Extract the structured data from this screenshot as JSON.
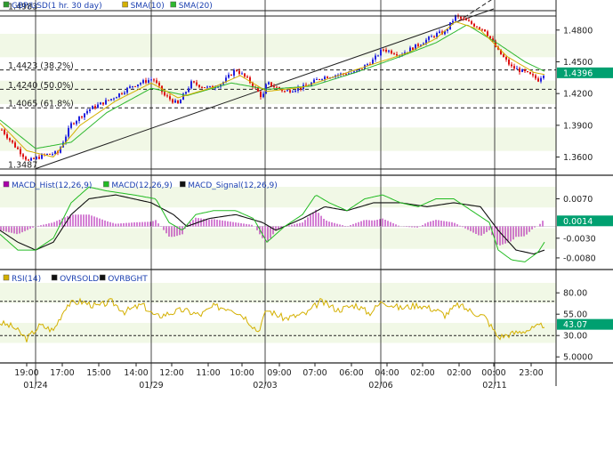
{
  "chart_data": [
    {
      "type": "line",
      "panel": "price",
      "legend": [
        {
          "label": "GBP/USD(1 hr.  30 day)",
          "color": "#2e9a2e"
        },
        {
          "label": "SMA(10)",
          "color": "#d4b000"
        },
        {
          "label": "SMA(20)",
          "color": "#2fb82f"
        }
      ],
      "yticks": [
        "1.4800",
        "1.4500",
        "1.4200",
        "1.3900",
        "1.3600"
      ],
      "ytick_values": [
        1.48,
        1.45,
        1.42,
        1.39,
        1.36
      ],
      "ylim": [
        1.347,
        1.5
      ],
      "current": {
        "label": "1.4396",
        "value": 1.4396
      },
      "hlines": [
        {
          "label": "1.4983",
          "value": 1.4983,
          "style": "solid"
        },
        {
          "label": "1.4423 (38.2%)",
          "value": 1.4423,
          "style": "dashed"
        },
        {
          "label": "1.4240 (50.0%)",
          "value": 1.424,
          "style": "dashed"
        },
        {
          "label": "1.4065 (61.8%)",
          "value": 1.4065,
          "style": "dashed"
        },
        {
          "label": "1.3487",
          "value": 1.3487,
          "style": "solid"
        }
      ],
      "price_keypoints": [
        [
          0,
          1.388
        ],
        [
          15,
          1.372
        ],
        [
          32,
          1.356
        ],
        [
          50,
          1.362
        ],
        [
          65,
          1.364
        ],
        [
          80,
          1.391
        ],
        [
          100,
          1.405
        ],
        [
          125,
          1.415
        ],
        [
          150,
          1.428
        ],
        [
          172,
          1.434
        ],
        [
          185,
          1.418
        ],
        [
          200,
          1.41
        ],
        [
          215,
          1.43
        ],
        [
          235,
          1.425
        ],
        [
          250,
          1.43
        ],
        [
          265,
          1.443
        ],
        [
          280,
          1.432
        ],
        [
          295,
          1.416
        ],
        [
          300,
          1.43
        ],
        [
          320,
          1.422
        ],
        [
          345,
          1.427
        ],
        [
          360,
          1.435
        ],
        [
          380,
          1.438
        ],
        [
          400,
          1.44
        ],
        [
          420,
          1.452
        ],
        [
          430,
          1.462
        ],
        [
          450,
          1.457
        ],
        [
          470,
          1.466
        ],
        [
          490,
          1.476
        ],
        [
          500,
          1.478
        ],
        [
          512,
          1.493
        ],
        [
          525,
          1.488
        ],
        [
          545,
          1.48
        ],
        [
          560,
          1.46
        ],
        [
          575,
          1.445
        ],
        [
          590,
          1.44
        ],
        [
          605,
          1.433
        ],
        [
          612,
          1.44
        ]
      ],
      "sma10_keypoints": [
        [
          0,
          1.392
        ],
        [
          30,
          1.366
        ],
        [
          60,
          1.36
        ],
        [
          90,
          1.39
        ],
        [
          130,
          1.413
        ],
        [
          170,
          1.43
        ],
        [
          200,
          1.416
        ],
        [
          240,
          1.426
        ],
        [
          270,
          1.437
        ],
        [
          300,
          1.422
        ],
        [
          340,
          1.426
        ],
        [
          380,
          1.437
        ],
        [
          420,
          1.448
        ],
        [
          460,
          1.459
        ],
        [
          490,
          1.472
        ],
        [
          512,
          1.488
        ],
        [
          540,
          1.48
        ],
        [
          570,
          1.455
        ],
        [
          600,
          1.44
        ],
        [
          612,
          1.438
        ]
      ],
      "sma20_keypoints": [
        [
          0,
          1.395
        ],
        [
          40,
          1.368
        ],
        [
          80,
          1.374
        ],
        [
          120,
          1.402
        ],
        [
          170,
          1.425
        ],
        [
          210,
          1.418
        ],
        [
          260,
          1.43
        ],
        [
          300,
          1.424
        ],
        [
          350,
          1.427
        ],
        [
          400,
          1.44
        ],
        [
          450,
          1.455
        ],
        [
          490,
          1.468
        ],
        [
          525,
          1.485
        ],
        [
          560,
          1.467
        ],
        [
          590,
          1.45
        ],
        [
          612,
          1.441
        ]
      ],
      "trendline": {
        "from": [
          40,
          1.349
        ],
        "to": [
          555,
          1.5
        ]
      }
    },
    {
      "type": "line",
      "panel": "macd",
      "legend": [
        {
          "label": "MACD_Hist(12,26,9)",
          "color": "#aa00aa"
        },
        {
          "label": "MACD(12,26,9)",
          "color": "#22bb22"
        },
        {
          "label": "MACD_Signal(12,26,9)",
          "color": "#111111"
        }
      ],
      "yticks": [
        "0.0070",
        "-0.0030",
        "-0.0080"
      ],
      "ytick_values": [
        0.007,
        -0.003,
        -0.008
      ],
      "ylim": [
        -0.0105,
        0.0105
      ],
      "current": {
        "label": "0.0014",
        "value": 0.0014
      },
      "macd_keypoints": [
        [
          0,
          -0.002
        ],
        [
          20,
          -0.006
        ],
        [
          40,
          -0.006
        ],
        [
          60,
          -0.003
        ],
        [
          80,
          0.006
        ],
        [
          100,
          0.01
        ],
        [
          120,
          0.009
        ],
        [
          150,
          0.008
        ],
        [
          175,
          0.007
        ],
        [
          190,
          0.001
        ],
        [
          205,
          -0.001
        ],
        [
          220,
          0.003
        ],
        [
          240,
          0.004
        ],
        [
          265,
          0.004
        ],
        [
          285,
          0.002
        ],
        [
          300,
          -0.004
        ],
        [
          320,
          0.0
        ],
        [
          340,
          0.003
        ],
        [
          355,
          0.008
        ],
        [
          370,
          0.006
        ],
        [
          390,
          0.004
        ],
        [
          410,
          0.007
        ],
        [
          430,
          0.008
        ],
        [
          450,
          0.006
        ],
        [
          470,
          0.005
        ],
        [
          490,
          0.007
        ],
        [
          510,
          0.007
        ],
        [
          530,
          0.004
        ],
        [
          550,
          0.001
        ],
        [
          560,
          -0.006
        ],
        [
          575,
          -0.0085
        ],
        [
          590,
          -0.009
        ],
        [
          605,
          -0.0065
        ],
        [
          612,
          -0.004
        ]
      ],
      "signal_keypoints": [
        [
          0,
          -0.001
        ],
        [
          20,
          -0.004
        ],
        [
          40,
          -0.006
        ],
        [
          60,
          -0.004
        ],
        [
          80,
          0.003
        ],
        [
          100,
          0.007
        ],
        [
          130,
          0.008
        ],
        [
          170,
          0.006
        ],
        [
          195,
          0.003
        ],
        [
          210,
          0.0
        ],
        [
          235,
          0.002
        ],
        [
          265,
          0.003
        ],
        [
          295,
          0.001
        ],
        [
          310,
          -0.001
        ],
        [
          340,
          0.002
        ],
        [
          365,
          0.005
        ],
        [
          390,
          0.004
        ],
        [
          420,
          0.006
        ],
        [
          450,
          0.006
        ],
        [
          480,
          0.005
        ],
        [
          510,
          0.006
        ],
        [
          540,
          0.005
        ],
        [
          560,
          -0.001
        ],
        [
          580,
          -0.006
        ],
        [
          600,
          -0.007
        ],
        [
          612,
          -0.006
        ]
      ]
    },
    {
      "type": "line",
      "panel": "rsi",
      "legend": [
        {
          "label": "RSI(14)",
          "color": "#d4b000"
        },
        {
          "label": "OVRSOLD",
          "color": "#111111"
        },
        {
          "label": "OVRBGHT",
          "color": "#111111"
        }
      ],
      "yticks": [
        "80.00",
        "55.00",
        "30.00",
        "5.0000"
      ],
      "ytick_values": [
        80,
        55,
        30,
        5
      ],
      "ylim": [
        0,
        100
      ],
      "current": {
        "label": "43.07",
        "value": 43.07
      },
      "overbought": 70,
      "oversold": 30,
      "rsi_keypoints": [
        [
          0,
          45
        ],
        [
          15,
          40
        ],
        [
          30,
          26
        ],
        [
          45,
          42
        ],
        [
          60,
          36
        ],
        [
          75,
          66
        ],
        [
          90,
          70
        ],
        [
          110,
          64
        ],
        [
          125,
          70
        ],
        [
          140,
          58
        ],
        [
          160,
          66
        ],
        [
          175,
          52
        ],
        [
          190,
          56
        ],
        [
          205,
          60
        ],
        [
          225,
          54
        ],
        [
          240,
          64
        ],
        [
          260,
          62
        ],
        [
          275,
          52
        ],
        [
          290,
          35
        ],
        [
          300,
          60
        ],
        [
          320,
          50
        ],
        [
          345,
          56
        ],
        [
          360,
          70
        ],
        [
          380,
          60
        ],
        [
          400,
          66
        ],
        [
          415,
          56
        ],
        [
          430,
          70
        ],
        [
          450,
          62
        ],
        [
          470,
          66
        ],
        [
          490,
          60
        ],
        [
          500,
          54
        ],
        [
          515,
          66
        ],
        [
          530,
          58
        ],
        [
          545,
          52
        ],
        [
          560,
          28
        ],
        [
          575,
          32
        ],
        [
          590,
          36
        ],
        [
          600,
          38
        ],
        [
          612,
          43
        ]
      ]
    }
  ],
  "x_axis": {
    "time_labels": [
      "19:00",
      "17:00",
      "15:00",
      "14:00",
      "12:00",
      "11:00",
      "10:00",
      "09:00",
      "07:00",
      "06:00",
      "04:00",
      "02:00",
      "02:00",
      "00:00",
      "23:00"
    ],
    "date_labels": [
      "01/24",
      "01/29",
      "02/03",
      "02/06",
      "02/11"
    ]
  },
  "colors": {
    "up_candle": "#2222dd",
    "down_candle": "#dd1111",
    "band": "#f1f8e6",
    "value_box": "#00a070"
  }
}
